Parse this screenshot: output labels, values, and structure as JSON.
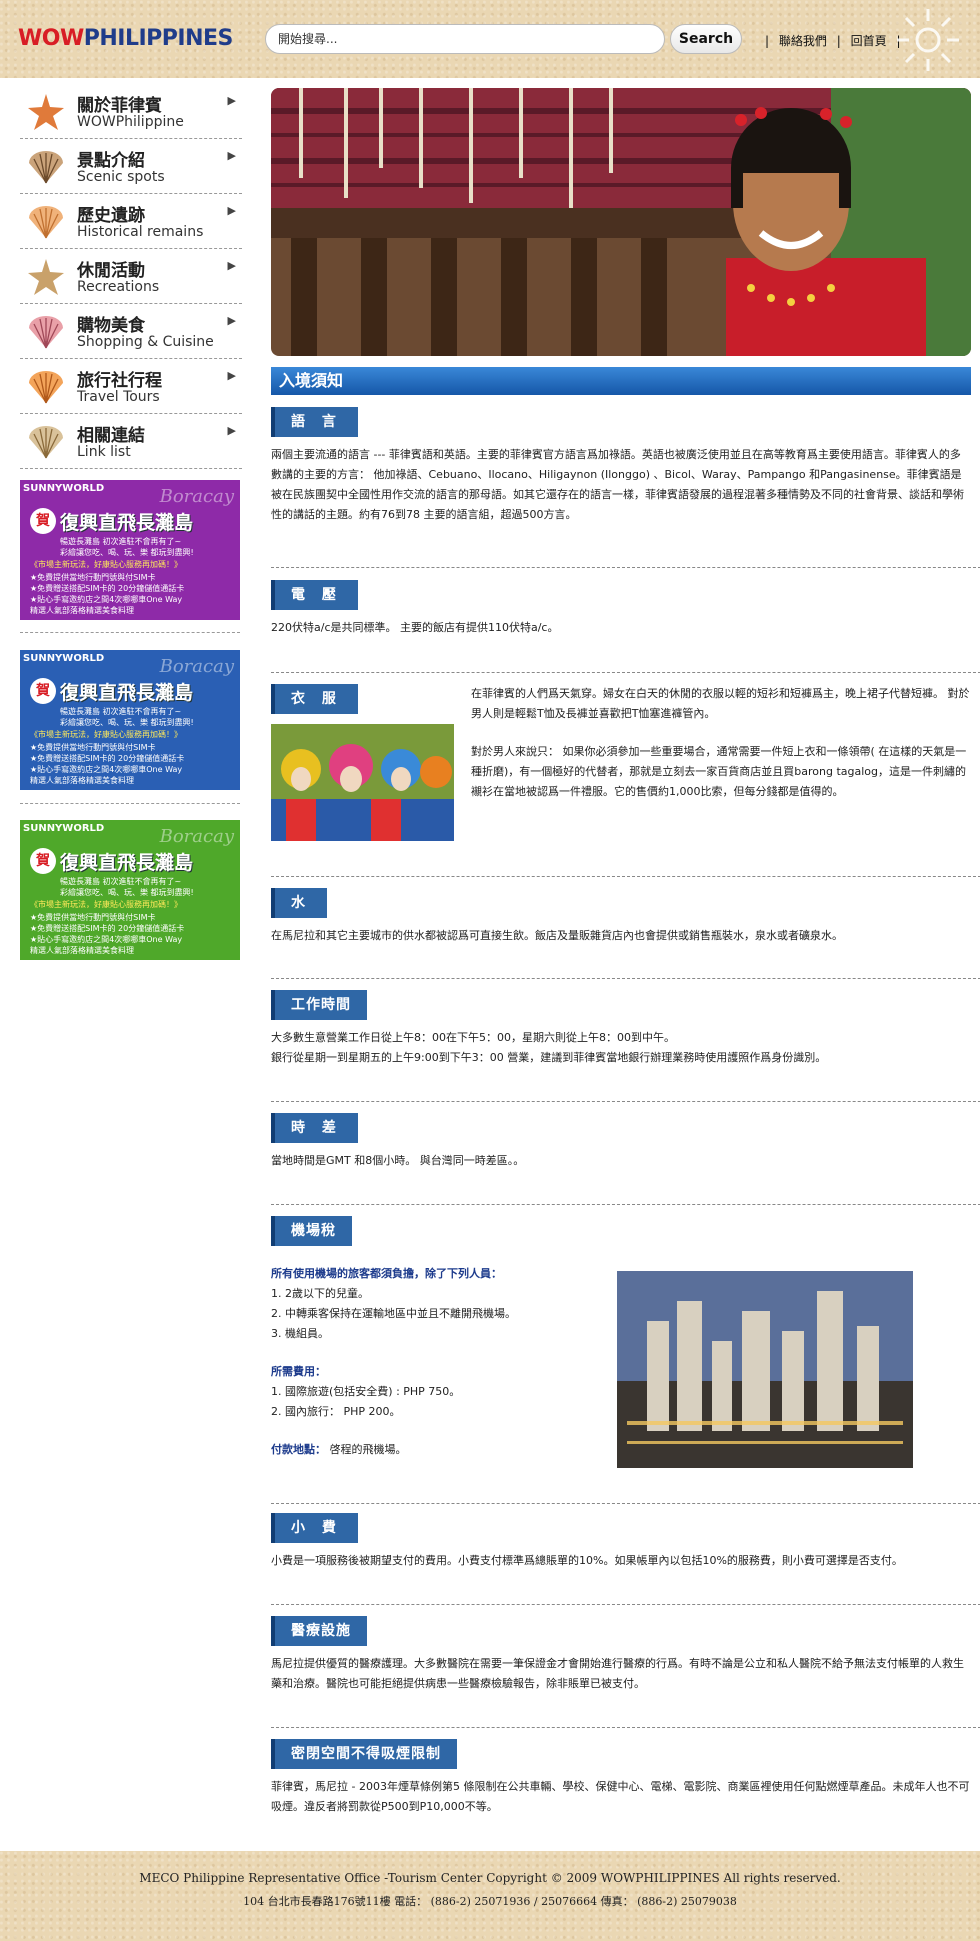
{
  "header": {
    "logo_wow": "WOW",
    "logo_ph": "PHILIPPINES",
    "search_placeholder": "開始搜尋...",
    "search_button": "Search",
    "links": [
      "聯絡我們",
      "回首頁"
    ],
    "sep": "|"
  },
  "sidebar": {
    "items": [
      {
        "zh": "關於菲律賓",
        "en": "WOWPhilippine",
        "icon": "starfish-icon"
      },
      {
        "zh": "景點介紹",
        "en": "Scenic spots",
        "icon": "shell-icon"
      },
      {
        "zh": "歷史遺跡",
        "en": "Historical remains",
        "icon": "scallop-icon"
      },
      {
        "zh": "休閒活動",
        "en": "Recreations",
        "icon": "starfish-icon"
      },
      {
        "zh": "購物美食",
        "en": "Shopping & Cuisine",
        "icon": "shell-icon"
      },
      {
        "zh": "旅行社行程",
        "en": "Travel Tours",
        "icon": "scallop-icon"
      },
      {
        "zh": "相關連結",
        "en": "Link list",
        "icon": "shell-icon"
      }
    ],
    "arrow": "▶",
    "banners": [
      {
        "brand": "SUNNYWORLD",
        "location": "Boracay",
        "he": "賀",
        "title": "復興直飛長灘島",
        "lines": [
          "暢遊長灘島 初次進駐不會再有了~",
          "彩繪讓您吃、喝、玩、樂 都玩到盡興!",
          "《市場主新玩法，好康貼心服務再加碼！》",
          "★免費提供當地行動門號與付SIM卡",
          "★免費贈送搭配SIM卡的 20分鐘儲值通話卡",
          "★貼心手寫邀約店之間4次哪哪車One Way",
          "精選人氣部落格精選美食料理"
        ],
        "color": "#8e2aa8"
      },
      {
        "brand": "SUNNYWORLD",
        "location": "Boracay",
        "he": "賀",
        "title": "復興直飛長灘島",
        "lines": [
          "暢遊長灘島 初次進駐不會再有了~",
          "彩繪讓您吃、喝、玩、樂 都玩到盡興!",
          "《市場主新玩法，好康貼心服務再加碼！》",
          "★免費提供當地行動門號與付SIM卡",
          "★免費贈送搭配SIM卡的 20分鐘儲值通話卡",
          "★貼心手寫邀約店之間4次哪哪車One Way",
          "精選人氣部落格精選美食料理"
        ],
        "color": "#2a5fb4"
      },
      {
        "brand": "SUNNYWORLD",
        "location": "Boracay",
        "he": "賀",
        "title": "復興直飛長灘島",
        "lines": [
          "暢遊長灘島 初次進駐不會再有了~",
          "彩繪讓您吃、喝、玩、樂 都玩到盡興!",
          "《市場主新玩法，好康貼心服務再加碼！》",
          "★免費提供當地行動門號與付SIM卡",
          "★免費贈送搭配SIM卡的 20分鐘儲值通話卡",
          "★貼心手寫邀約店之間4次哪哪車One Way",
          "精選人氣部落格精選美食料理"
        ],
        "color": "#4fa82a"
      }
    ]
  },
  "main": {
    "title": "入境須知",
    "sections": {
      "lang": {
        "tag": "語 言",
        "text": "兩個主要流通的語言 --- 菲律賓語和英語。主要的菲律賓官方語言爲加祿語。英語也被廣泛使用並且在高等教育爲主要使用語言。菲律賓人的多數講的主要的方言： 他加祿語、Cebuano、Ilocano、Hiligaynon (Ilonggo) 、Bicol、Waray、Pampango 和Pangasinense。菲律賓語是被在民族團契中全國性用作交流的語言的那母語。如其它還存在的語言一樣，菲律賓語發展的過程混著多種情勢及不同的社會背景、談話和學術性的講話的主題。約有76到78 主要的語言組，超過500方言。"
      },
      "power": {
        "tag": "電 壓",
        "text": "220伏特a/c是共同標準。 主要的飯店有提供110伏特a/c。"
      },
      "cloth": {
        "tag": "衣 服",
        "p1": "在菲律賓的人們爲天氣穿。婦女在白天的休閒的衣服以輕的短衫和短褲爲主，晚上裙子代替短褲。 對於男人則是輕鬆T恤及長褲並喜歡把T恤塞進褲管內。",
        "p2": "對於男人來說只： 如果你必須參加一些重要場合，通常需要一件短上衣和一條領帶( 在這樣的天氣是一種折磨)，有一個極好的代替者，那就是立刻去一家百貨商店並且買barong tagalog，這是一件刺繡的襯衫在當地被認爲一件禮服。它的售價約1,000比索，但每分錢都是值得的。"
      },
      "water": {
        "tag": "水",
        "text": "在馬尼拉和其它主要城市的供水都被認爲可直接生飲。飯店及量販雜貨店內也會提供或銷售瓶裝水，泉水或者礦泉水。"
      },
      "hours": {
        "tag": "工作時間",
        "t1": "大多數生意營業工作日從上午8：00在下午5：00，星期六則從上午8：00到中午。",
        "t2": "銀行從星期一到星期五的上午9:00到下午3：00 營業，建議到菲律賓當地銀行辦理業務時使用護照作爲身份識別。"
      },
      "tz": {
        "tag": "時 差",
        "text": "當地時間是GMT 和8個小時。 與台灣同一時差區。。"
      },
      "tax": {
        "tag": "機場稅",
        "h1": "所有使用機場的旅客都須負擔，除了下列人員：",
        "items": [
          "1. 2歲以下的兒童。",
          "2. 中轉乘客保持在運輸地區中並且不離開飛機場。",
          "3. 機組員。"
        ],
        "h2": "所需費用：",
        "fees": [
          "1. 國際旅遊(包括安全費) : PHP 750。",
          "2. 國內旅行： PHP 200。"
        ],
        "h3": "付款地點：",
        "pay": "啓程的飛機場。"
      },
      "tip": {
        "tag": "小 費",
        "text": "小費是一項服務後被期望支付的費用。小費支付標準爲總賬單的10%。如果帳單內以包括10%的服務費，則小費可選擇是否支付。"
      },
      "med": {
        "tag": "醫療設施",
        "text": "馬尼拉提供優質的醫療護理。大多數醫院在需要一筆保證金才會開始進行醫療的行爲。有時不論是公立和私人醫院不給予無法支付帳單的人救生藥和治療。醫院也可能拒絕提供病患一些醫療檢驗報告，除非賬單已被支付。"
      },
      "smoke": {
        "tag": "密閉空間不得吸煙限制",
        "text": "菲律賓，馬尼拉 - 2003年煙草條例第5 條限制在公共車輛、學校、保健中心、電梯、電影院、商業區裡使用任何點燃煙草產品。未成年人也不可吸煙。違反者將罰款從P500到P10,000不等。"
      }
    }
  },
  "footer": {
    "l1": "MECO Philippine Representative Office -Tourism Center     Copyright © 2009 WOWPHILIPPINES All rights reserved.",
    "l2": "104 台北市長春路176號11樓      電話： (886-2) 25071936 / 25076664      傳真： (886-2) 25079038"
  }
}
